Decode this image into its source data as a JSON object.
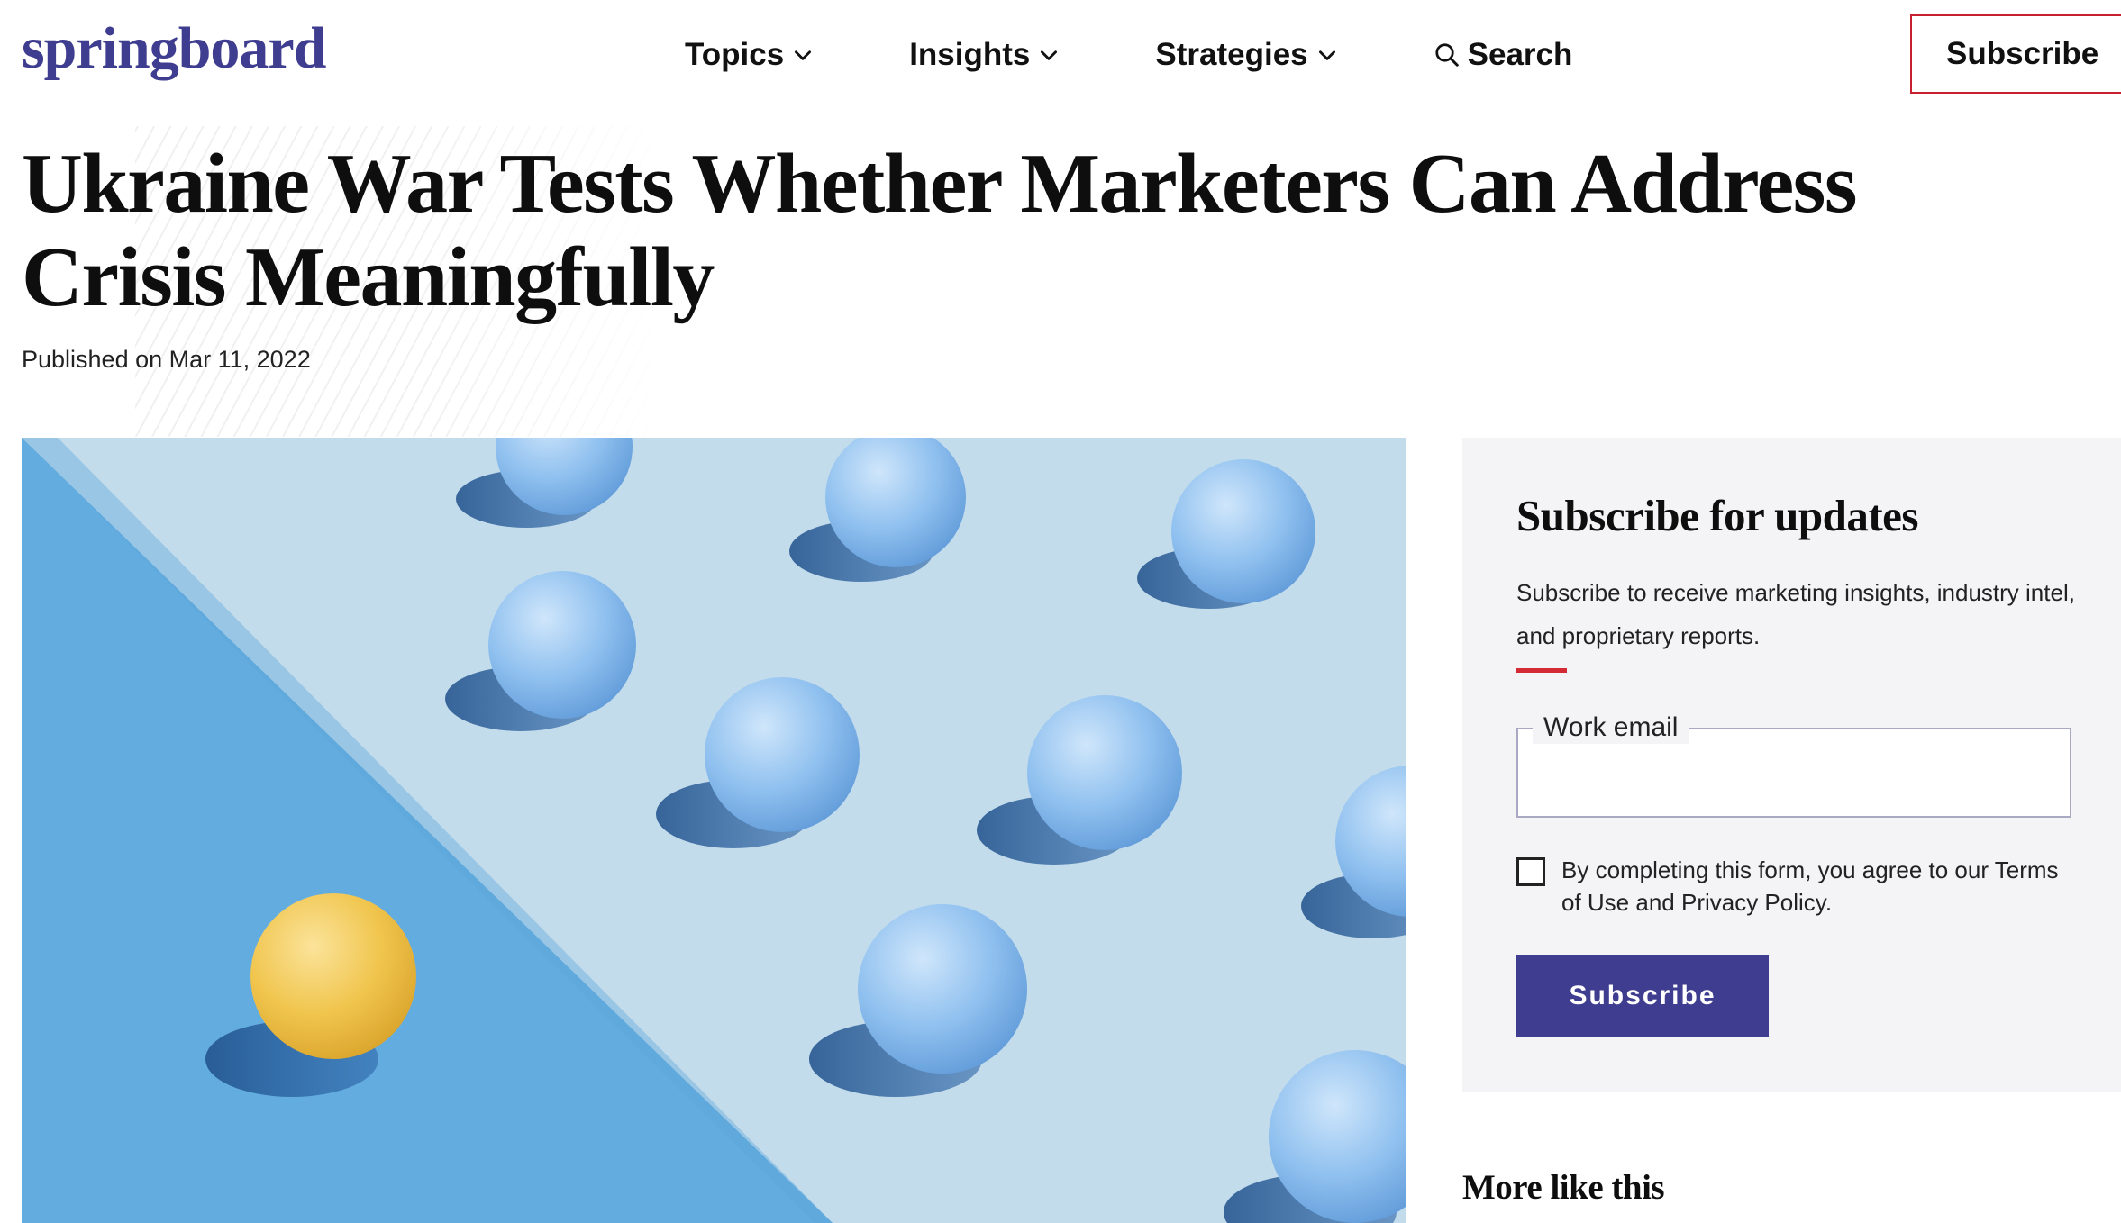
{
  "header": {
    "logo": "springboard",
    "nav": [
      {
        "label": "Topics"
      },
      {
        "label": "Insights"
      },
      {
        "label": "Strategies"
      }
    ],
    "search_label": "Search",
    "subscribe_label": "Subscribe"
  },
  "article": {
    "title": "Ukraine War Tests Whether Marketers Can Address Crisis Meaningfully",
    "published": "Published on Mar 11, 2022"
  },
  "subscribe_box": {
    "title": "Subscribe for updates",
    "description": "Subscribe to receive marketing insights, industry intel, and proprietary reports.",
    "email_label": "Work email",
    "email_value": "",
    "agreement": "By completing this form, you agree to our Terms of Use and Privacy Policy.",
    "agreement_checked": false,
    "button_label": "Subscribe"
  },
  "sidebar": {
    "more_heading": "More like this"
  },
  "colors": {
    "brand": "#3f3d8f",
    "accent_red": "#d42a35",
    "panel_bg": "#f4f4f7"
  },
  "icons": {
    "search": "magnifier-icon",
    "chevron": "chevron-down-icon"
  }
}
